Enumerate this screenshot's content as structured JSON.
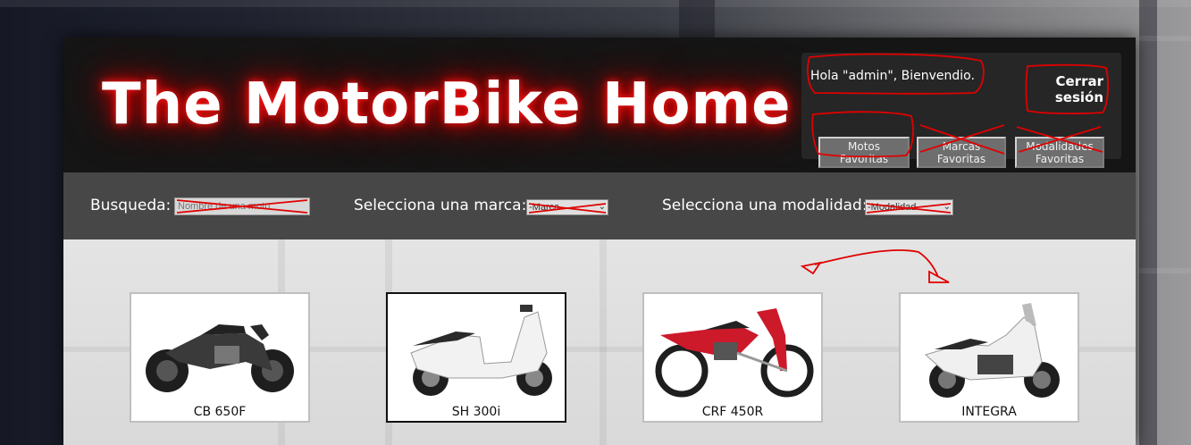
{
  "site": {
    "title": "The MotorBike Home"
  },
  "user_box": {
    "greeting": "Hola \"admin\", Bienvendio.",
    "logout_line1": "Cerrar",
    "logout_line2": "sesión",
    "buttons": [
      {
        "line1": "Motos",
        "line2": "Favoritas"
      },
      {
        "line1": "Marcas",
        "line2": "Favoritas"
      },
      {
        "line1": "Modalidades",
        "line2": "Favoritas"
      }
    ]
  },
  "filters": {
    "search_label": "Busqueda:",
    "search_placeholder": "Nombre de una moto",
    "brand_label": "Selecciona una marca:",
    "brand_selected": "-Marca-",
    "mode_label": "Selecciona una modalidad:",
    "mode_selected": "-Modalidad-"
  },
  "motorbikes": [
    {
      "name": "CB 650F",
      "color": "#3a3a3a"
    },
    {
      "name": "SH 300i",
      "color": "#f2f2f2"
    },
    {
      "name": "CRF 450R",
      "color": "#cc1a2a"
    },
    {
      "name": "INTEGRA",
      "color": "#f0f0f0"
    }
  ],
  "colors": {
    "header_bg": "#151515",
    "search_bar_bg": "#474747",
    "content_bg": "#e0e0e0",
    "title_glow": "#d10000",
    "annotation_red": "#e00000"
  }
}
